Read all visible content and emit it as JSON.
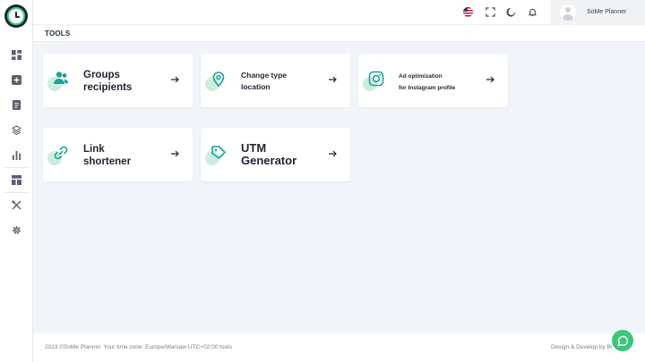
{
  "header": {
    "user_name": "SoMe Planner",
    "flag_icon": "us-flag-icon",
    "icons": [
      "fullscreen-icon",
      "moon-icon",
      "bell-icon"
    ]
  },
  "sidebar": {
    "items": [
      {
        "name": "dashboard",
        "icon": "grid-icon"
      },
      {
        "name": "add",
        "icon": "plus-square-icon"
      },
      {
        "name": "posts",
        "icon": "document-icon"
      },
      {
        "name": "layers",
        "icon": "layers-icon"
      },
      {
        "name": "statistics",
        "icon": "bar-chart-icon"
      },
      {
        "name": "layout",
        "icon": "layout-icon"
      },
      {
        "name": "tools",
        "icon": "tools-icon"
      },
      {
        "name": "settings",
        "icon": "gear-icon"
      }
    ]
  },
  "page": {
    "title": "TOOLS"
  },
  "tools": [
    {
      "id": "groups",
      "line1": "Groups",
      "line2": "recipients",
      "icon": "users-icon"
    },
    {
      "id": "location",
      "line1": "Change type",
      "line2": "location",
      "icon": "map-pin-icon"
    },
    {
      "id": "instagram",
      "line1": "Ad optimization",
      "line2": "for Instagram profile",
      "icon": "instagram-icon"
    },
    {
      "id": "link",
      "line1": "Link",
      "line2": "shortener",
      "icon": "link-icon"
    },
    {
      "id": "utm",
      "line1": "UTM",
      "line2": "Generator",
      "icon": "tag-icon"
    }
  ],
  "footer": {
    "left": "2023 ©SoMe Planner. Your time zone: Europe/Warsaw UTC+02:00 tools",
    "right": "Design & Develop by Br"
  },
  "colors": {
    "accent": "#1aa39a",
    "accent_light": "#cdeedd",
    "chat": "#3bc77b",
    "logo_ring": "#3bd08a"
  }
}
